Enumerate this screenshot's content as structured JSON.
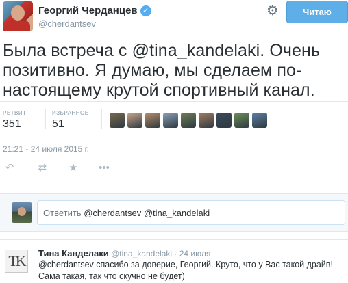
{
  "author": {
    "name": "Георгий Черданцев",
    "handle": "@cherdantsev"
  },
  "follow_button": {
    "label": "Читаю"
  },
  "tweet": {
    "text_parts": [
      "Была встреча с ",
      "@tina_kandelaki",
      ". Очень позитивно. Я думаю, мы сделаем по-настоящему крутой спортивный канал."
    ]
  },
  "stats": {
    "retweets_label": "РЕТВИТ",
    "retweets_value": "351",
    "favorites_label": "ИЗБРАННОЕ",
    "favorites_value": "51"
  },
  "favoriters": [
    {
      "color": "#7a6a4e"
    },
    {
      "color": "#c9a48a"
    },
    {
      "color": "#b98c6a"
    },
    {
      "color": "#8aa0b8"
    },
    {
      "color": "#6f7d55"
    },
    {
      "color": "#a47c62"
    },
    {
      "color": "#3c4a5a"
    },
    {
      "color": "#6b8f5a"
    },
    {
      "color": "#5b7fa4"
    }
  ],
  "timestamp": "21:21 - 24 июля 2015 г.",
  "actions": {
    "reply_icon": "reply-icon",
    "retweet_icon": "retweet-icon",
    "favorite_icon": "star-icon",
    "more_icon": "more-icon"
  },
  "reply_box": {
    "prefix": "Ответить ",
    "mentions": "@cherdantsev @tina_kandelaki"
  },
  "reply": {
    "logo_text": "TK",
    "name": "Тина Канделаки",
    "handle": "@tina_kandelaki",
    "date": "· 24 июля",
    "text": "@cherdantsev спасибо за доверие, Георгий. Круто, что у Вас такой драйв! Сама такая, так что скучно не будет)"
  },
  "colors": {
    "accent": "#55acee",
    "muted": "#8899a6",
    "text": "#292f33"
  }
}
